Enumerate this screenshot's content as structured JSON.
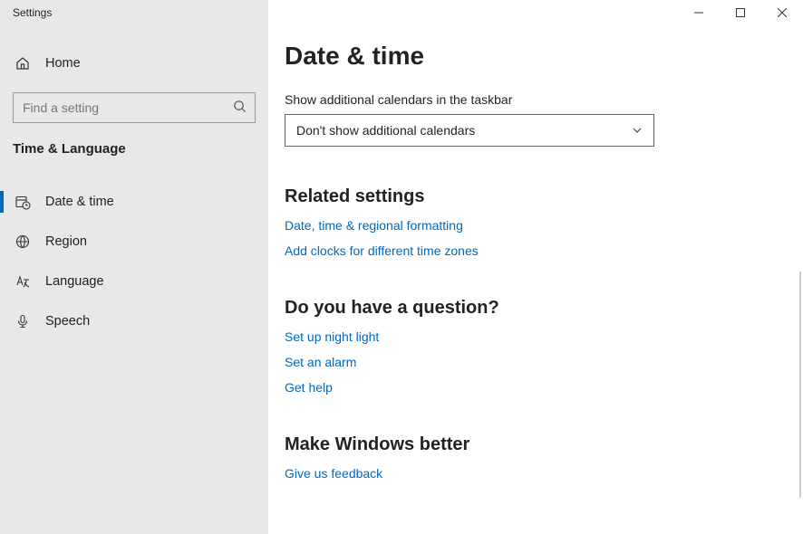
{
  "window": {
    "title": "Settings"
  },
  "sidebar": {
    "home": "Home",
    "search_placeholder": "Find a setting",
    "category": "Time & Language",
    "items": [
      {
        "label": "Date & time",
        "active": true
      },
      {
        "label": "Region",
        "active": false
      },
      {
        "label": "Language",
        "active": false
      },
      {
        "label": "Speech",
        "active": false
      }
    ]
  },
  "main": {
    "heading": "Date & time",
    "calendar_label": "Show additional calendars in the taskbar",
    "calendar_value": "Don't show additional calendars",
    "related_heading": "Related settings",
    "related_links": [
      "Date, time & regional formatting",
      "Add clocks for different time zones"
    ],
    "question_heading": "Do you have a question?",
    "question_links": [
      "Set up night light",
      "Set an alarm",
      "Get help"
    ],
    "better_heading": "Make Windows better",
    "better_links": [
      "Give us feedback"
    ]
  }
}
